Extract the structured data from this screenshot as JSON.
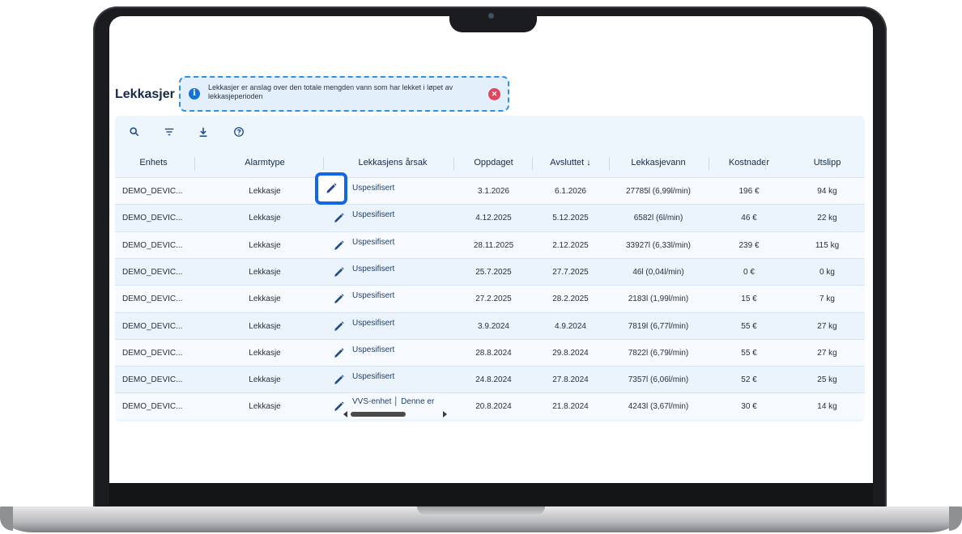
{
  "page": {
    "title": "Lekkasjer",
    "info_text": "Lekkasjer er anslag over den totale mengden vann som har lekket i løpet av lekkasjeperioden",
    "info_icon": "info-icon",
    "close_icon": "close-circle-icon"
  },
  "toolbar": {
    "icons": [
      "search-icon",
      "filter-icon",
      "download-icon",
      "help-icon"
    ]
  },
  "columns": {
    "device": "Enhets",
    "alarm_type": "Alarmtype",
    "cause": "Lekkasjens årsak",
    "discovered": "Oppdaget",
    "ended": "Avsluttet ↓",
    "water": "Lekkasjevann",
    "cost": "Kostnader",
    "emission": "Utslipp"
  },
  "rows": [
    {
      "device": "DEMO_DEVIC...",
      "alarm_type": "Lekkasje",
      "cause": "Uspesifisert",
      "discovered": "3.1.2026",
      "ended": "6.1.2026",
      "water": "27785l (6,99l/min)",
      "cost": "196 €",
      "emission": "94 kg"
    },
    {
      "device": "DEMO_DEVIC...",
      "alarm_type": "Lekkasje",
      "cause": "Uspesifisert",
      "discovered": "4.12.2025",
      "ended": "5.12.2025",
      "water": "6582l (6l/min)",
      "cost": "46 €",
      "emission": "22 kg"
    },
    {
      "device": "DEMO_DEVIC...",
      "alarm_type": "Lekkasje",
      "cause": "Uspesifisert",
      "discovered": "28.11.2025",
      "ended": "2.12.2025",
      "water": "33927l (6,33l/min)",
      "cost": "239 €",
      "emission": "115 kg"
    },
    {
      "device": "DEMO_DEVIC...",
      "alarm_type": "Lekkasje",
      "cause": "Uspesifisert",
      "discovered": "25.7.2025",
      "ended": "27.7.2025",
      "water": "46l (0,04l/min)",
      "cost": "0 €",
      "emission": "0 kg"
    },
    {
      "device": "DEMO_DEVIC...",
      "alarm_type": "Lekkasje",
      "cause": "Uspesifisert",
      "discovered": "27.2.2025",
      "ended": "28.2.2025",
      "water": "2183l (1,99l/min)",
      "cost": "15 €",
      "emission": "7 kg"
    },
    {
      "device": "DEMO_DEVIC...",
      "alarm_type": "Lekkasje",
      "cause": "Uspesifisert",
      "discovered": "3.9.2024",
      "ended": "4.9.2024",
      "water": "7819l (6,77l/min)",
      "cost": "55 €",
      "emission": "27 kg"
    },
    {
      "device": "DEMO_DEVIC...",
      "alarm_type": "Lekkasje",
      "cause": "Uspesifisert",
      "discovered": "28.8.2024",
      "ended": "29.8.2024",
      "water": "7822l (6,79l/min)",
      "cost": "55 €",
      "emission": "27 kg"
    },
    {
      "device": "DEMO_DEVIC...",
      "alarm_type": "Lekkasje",
      "cause": "Uspesifisert",
      "discovered": "24.8.2024",
      "ended": "27.8.2024",
      "water": "7357l (6,06l/min)",
      "cost": "52 €",
      "emission": "25 kg"
    },
    {
      "device": "DEMO_DEVIC...",
      "alarm_type": "Lekkasje",
      "cause": "VVS-enhet │ Denne er",
      "discovered": "20.8.2024",
      "ended": "21.8.2024",
      "water": "4243l (3,67l/min)",
      "cost": "30 €",
      "emission": "14 kg"
    }
  ],
  "colors": {
    "accent": "#1366e6",
    "banner_border": "#2f8fe0",
    "banner_bg": "#e3f0fb",
    "close_red": "#e0475f",
    "edit_icon": "#1f4b86"
  }
}
